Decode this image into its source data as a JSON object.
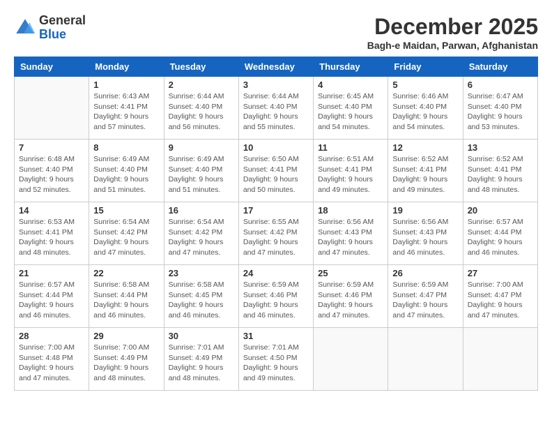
{
  "header": {
    "logo_general": "General",
    "logo_blue": "Blue",
    "month_title": "December 2025",
    "location": "Bagh-e Maidan, Parwan, Afghanistan"
  },
  "calendar": {
    "days_of_week": [
      "Sunday",
      "Monday",
      "Tuesday",
      "Wednesday",
      "Thursday",
      "Friday",
      "Saturday"
    ],
    "weeks": [
      [
        {
          "day": "",
          "info": ""
        },
        {
          "day": "1",
          "info": "Sunrise: 6:43 AM\nSunset: 4:41 PM\nDaylight: 9 hours\nand 57 minutes."
        },
        {
          "day": "2",
          "info": "Sunrise: 6:44 AM\nSunset: 4:40 PM\nDaylight: 9 hours\nand 56 minutes."
        },
        {
          "day": "3",
          "info": "Sunrise: 6:44 AM\nSunset: 4:40 PM\nDaylight: 9 hours\nand 55 minutes."
        },
        {
          "day": "4",
          "info": "Sunrise: 6:45 AM\nSunset: 4:40 PM\nDaylight: 9 hours\nand 54 minutes."
        },
        {
          "day": "5",
          "info": "Sunrise: 6:46 AM\nSunset: 4:40 PM\nDaylight: 9 hours\nand 54 minutes."
        },
        {
          "day": "6",
          "info": "Sunrise: 6:47 AM\nSunset: 4:40 PM\nDaylight: 9 hours\nand 53 minutes."
        }
      ],
      [
        {
          "day": "7",
          "info": "Sunrise: 6:48 AM\nSunset: 4:40 PM\nDaylight: 9 hours\nand 52 minutes."
        },
        {
          "day": "8",
          "info": "Sunrise: 6:49 AM\nSunset: 4:40 PM\nDaylight: 9 hours\nand 51 minutes."
        },
        {
          "day": "9",
          "info": "Sunrise: 6:49 AM\nSunset: 4:40 PM\nDaylight: 9 hours\nand 51 minutes."
        },
        {
          "day": "10",
          "info": "Sunrise: 6:50 AM\nSunset: 4:41 PM\nDaylight: 9 hours\nand 50 minutes."
        },
        {
          "day": "11",
          "info": "Sunrise: 6:51 AM\nSunset: 4:41 PM\nDaylight: 9 hours\nand 49 minutes."
        },
        {
          "day": "12",
          "info": "Sunrise: 6:52 AM\nSunset: 4:41 PM\nDaylight: 9 hours\nand 49 minutes."
        },
        {
          "day": "13",
          "info": "Sunrise: 6:52 AM\nSunset: 4:41 PM\nDaylight: 9 hours\nand 48 minutes."
        }
      ],
      [
        {
          "day": "14",
          "info": "Sunrise: 6:53 AM\nSunset: 4:41 PM\nDaylight: 9 hours\nand 48 minutes."
        },
        {
          "day": "15",
          "info": "Sunrise: 6:54 AM\nSunset: 4:42 PM\nDaylight: 9 hours\nand 47 minutes."
        },
        {
          "day": "16",
          "info": "Sunrise: 6:54 AM\nSunset: 4:42 PM\nDaylight: 9 hours\nand 47 minutes."
        },
        {
          "day": "17",
          "info": "Sunrise: 6:55 AM\nSunset: 4:42 PM\nDaylight: 9 hours\nand 47 minutes."
        },
        {
          "day": "18",
          "info": "Sunrise: 6:56 AM\nSunset: 4:43 PM\nDaylight: 9 hours\nand 47 minutes."
        },
        {
          "day": "19",
          "info": "Sunrise: 6:56 AM\nSunset: 4:43 PM\nDaylight: 9 hours\nand 46 minutes."
        },
        {
          "day": "20",
          "info": "Sunrise: 6:57 AM\nSunset: 4:44 PM\nDaylight: 9 hours\nand 46 minutes."
        }
      ],
      [
        {
          "day": "21",
          "info": "Sunrise: 6:57 AM\nSunset: 4:44 PM\nDaylight: 9 hours\nand 46 minutes."
        },
        {
          "day": "22",
          "info": "Sunrise: 6:58 AM\nSunset: 4:44 PM\nDaylight: 9 hours\nand 46 minutes."
        },
        {
          "day": "23",
          "info": "Sunrise: 6:58 AM\nSunset: 4:45 PM\nDaylight: 9 hours\nand 46 minutes."
        },
        {
          "day": "24",
          "info": "Sunrise: 6:59 AM\nSunset: 4:46 PM\nDaylight: 9 hours\nand 46 minutes."
        },
        {
          "day": "25",
          "info": "Sunrise: 6:59 AM\nSunset: 4:46 PM\nDaylight: 9 hours\nand 47 minutes."
        },
        {
          "day": "26",
          "info": "Sunrise: 6:59 AM\nSunset: 4:47 PM\nDaylight: 9 hours\nand 47 minutes."
        },
        {
          "day": "27",
          "info": "Sunrise: 7:00 AM\nSunset: 4:47 PM\nDaylight: 9 hours\nand 47 minutes."
        }
      ],
      [
        {
          "day": "28",
          "info": "Sunrise: 7:00 AM\nSunset: 4:48 PM\nDaylight: 9 hours\nand 47 minutes."
        },
        {
          "day": "29",
          "info": "Sunrise: 7:00 AM\nSunset: 4:49 PM\nDaylight: 9 hours\nand 48 minutes."
        },
        {
          "day": "30",
          "info": "Sunrise: 7:01 AM\nSunset: 4:49 PM\nDaylight: 9 hours\nand 48 minutes."
        },
        {
          "day": "31",
          "info": "Sunrise: 7:01 AM\nSunset: 4:50 PM\nDaylight: 9 hours\nand 49 minutes."
        },
        {
          "day": "",
          "info": ""
        },
        {
          "day": "",
          "info": ""
        },
        {
          "day": "",
          "info": ""
        }
      ]
    ]
  }
}
